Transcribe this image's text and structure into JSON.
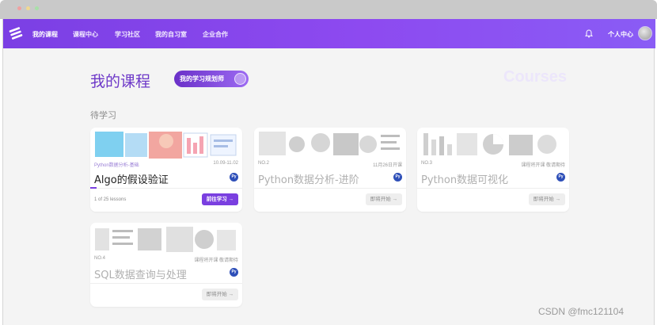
{
  "nav": {
    "items": [
      {
        "label": "我的课程",
        "active": true
      },
      {
        "label": "课程中心",
        "active": false
      },
      {
        "label": "学习社区",
        "active": false
      },
      {
        "label": "我的自习室",
        "active": false
      },
      {
        "label": "企业合作",
        "active": false
      }
    ],
    "user_label": "个人中心",
    "logo_icon": "stack-logo-icon",
    "bell_icon": "bell-icon"
  },
  "header": {
    "title": "我的课程",
    "planner_button": "我的学习规划师",
    "ghost_title": "Courses"
  },
  "section": {
    "label": "待学习"
  },
  "courses": [
    {
      "meta_left": "Python数据分析-基础",
      "meta_right": "10.09-11.02",
      "title": "Algo的假设验证",
      "badge": "Py",
      "progress_text": "1 of 25 lessons",
      "progress": 0.04,
      "cta": "前往学习 →",
      "active": true
    },
    {
      "meta_left": "NO.2",
      "meta_right": "11月26日开课",
      "title": "Python数据分析-进阶",
      "badge": "Py",
      "cta": "即将开始 →",
      "active": false
    },
    {
      "meta_left": "NO.3",
      "meta_right": "课程将开课  敬请期待",
      "title": "Python数据可视化",
      "badge": "Py",
      "cta": "即将开始 →",
      "active": false
    },
    {
      "meta_left": "NO.4",
      "meta_right": "课程将开课  敬请期待",
      "title": "SQL数据查询与处理",
      "badge": "Py",
      "cta": "即将开始 →",
      "active": false
    }
  ],
  "watermark": "CSDN  @fmc121104",
  "colors": {
    "accent": "#7a3fe0",
    "nav_bg": "#8646ec",
    "page_bg": "#f4f4f4"
  }
}
